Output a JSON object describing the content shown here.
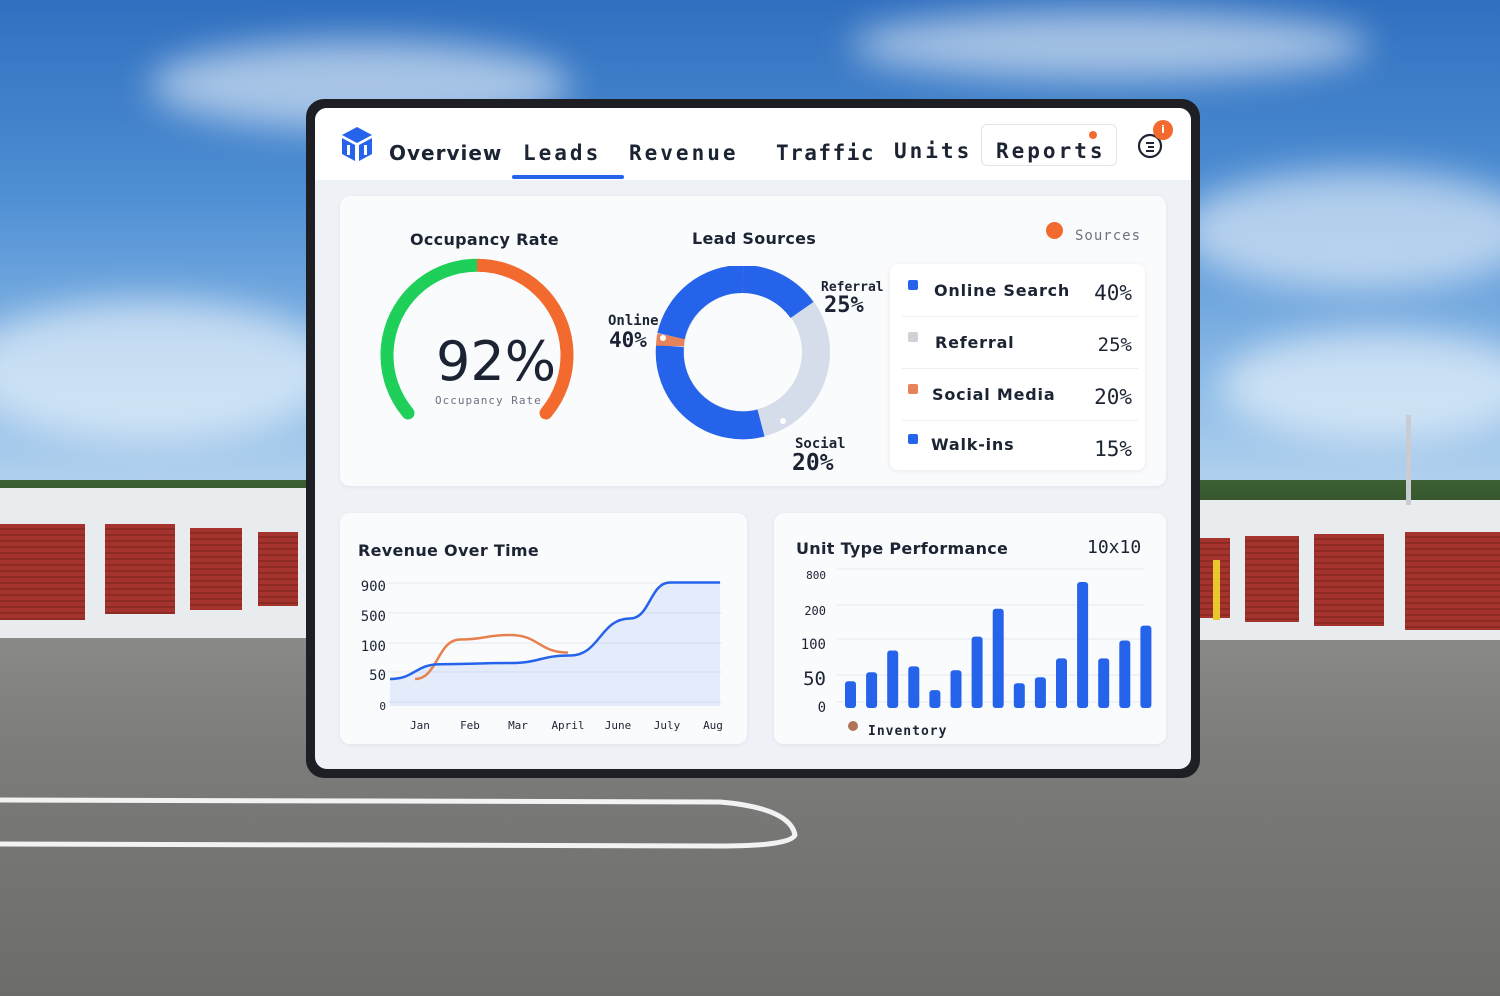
{
  "nav": {
    "tabs": [
      {
        "label": "Overview"
      },
      {
        "label": "Leads"
      },
      {
        "label": "Revenue"
      },
      {
        "label": "Traffic"
      },
      {
        "label": "Units"
      },
      {
        "label": "Reports"
      }
    ],
    "active_tab": "Leads",
    "notification_badge": "i"
  },
  "occupancy": {
    "title": "Occupancy Rate",
    "value": "92%",
    "caption": "Occupancy Rate",
    "colors": {
      "start": "#1ed05a",
      "end": "#f26a2e"
    }
  },
  "lead_sources": {
    "title": "Lead Sources",
    "sources_label": "Sources",
    "donut_labels": [
      {
        "name": "Online",
        "value": "40%"
      },
      {
        "name": "Referral",
        "value": "25%"
      },
      {
        "name": "Social",
        "value": "20%"
      }
    ],
    "legend": [
      {
        "name": "Online Search",
        "value": "40%",
        "color": "#2563eb"
      },
      {
        "name": "Referral",
        "value": "25%",
        "color": "#cfd3d8"
      },
      {
        "name": "Social Media",
        "value": "20%",
        "color": "#e8825a"
      },
      {
        "name": "Walk-ins",
        "value": "15%",
        "color": "#2563eb"
      }
    ]
  },
  "revenue": {
    "title": "Revenue Over Time"
  },
  "units": {
    "title": "Unit Type Performance",
    "unit_size": "10x10",
    "legend": "Inventory"
  },
  "chart_data": [
    {
      "type": "line",
      "title": "Revenue Over Time",
      "y_ticks": [
        "900",
        "500",
        "100",
        "50",
        "0"
      ],
      "categories": [
        "Jan",
        "Feb",
        "Mar",
        "April",
        "June",
        "July",
        "Aug"
      ],
      "series": [
        {
          "color": "#2563eb",
          "values": [
            35,
            60,
            62,
            75,
            400,
            880,
            880
          ]
        },
        {
          "color": "#e8804e",
          "values": [
            35,
            120,
            180,
            80
          ]
        }
      ]
    },
    {
      "type": "bar",
      "title": "Unit Type Performance",
      "y_ticks": [
        "800",
        "200",
        "100",
        "50",
        "0"
      ],
      "values": [
        27,
        36,
        58,
        42,
        18,
        38,
        72,
        100,
        25,
        31,
        50,
        127,
        50,
        68,
        83
      ],
      "color": "#2563eb",
      "legend": "Inventory"
    }
  ]
}
